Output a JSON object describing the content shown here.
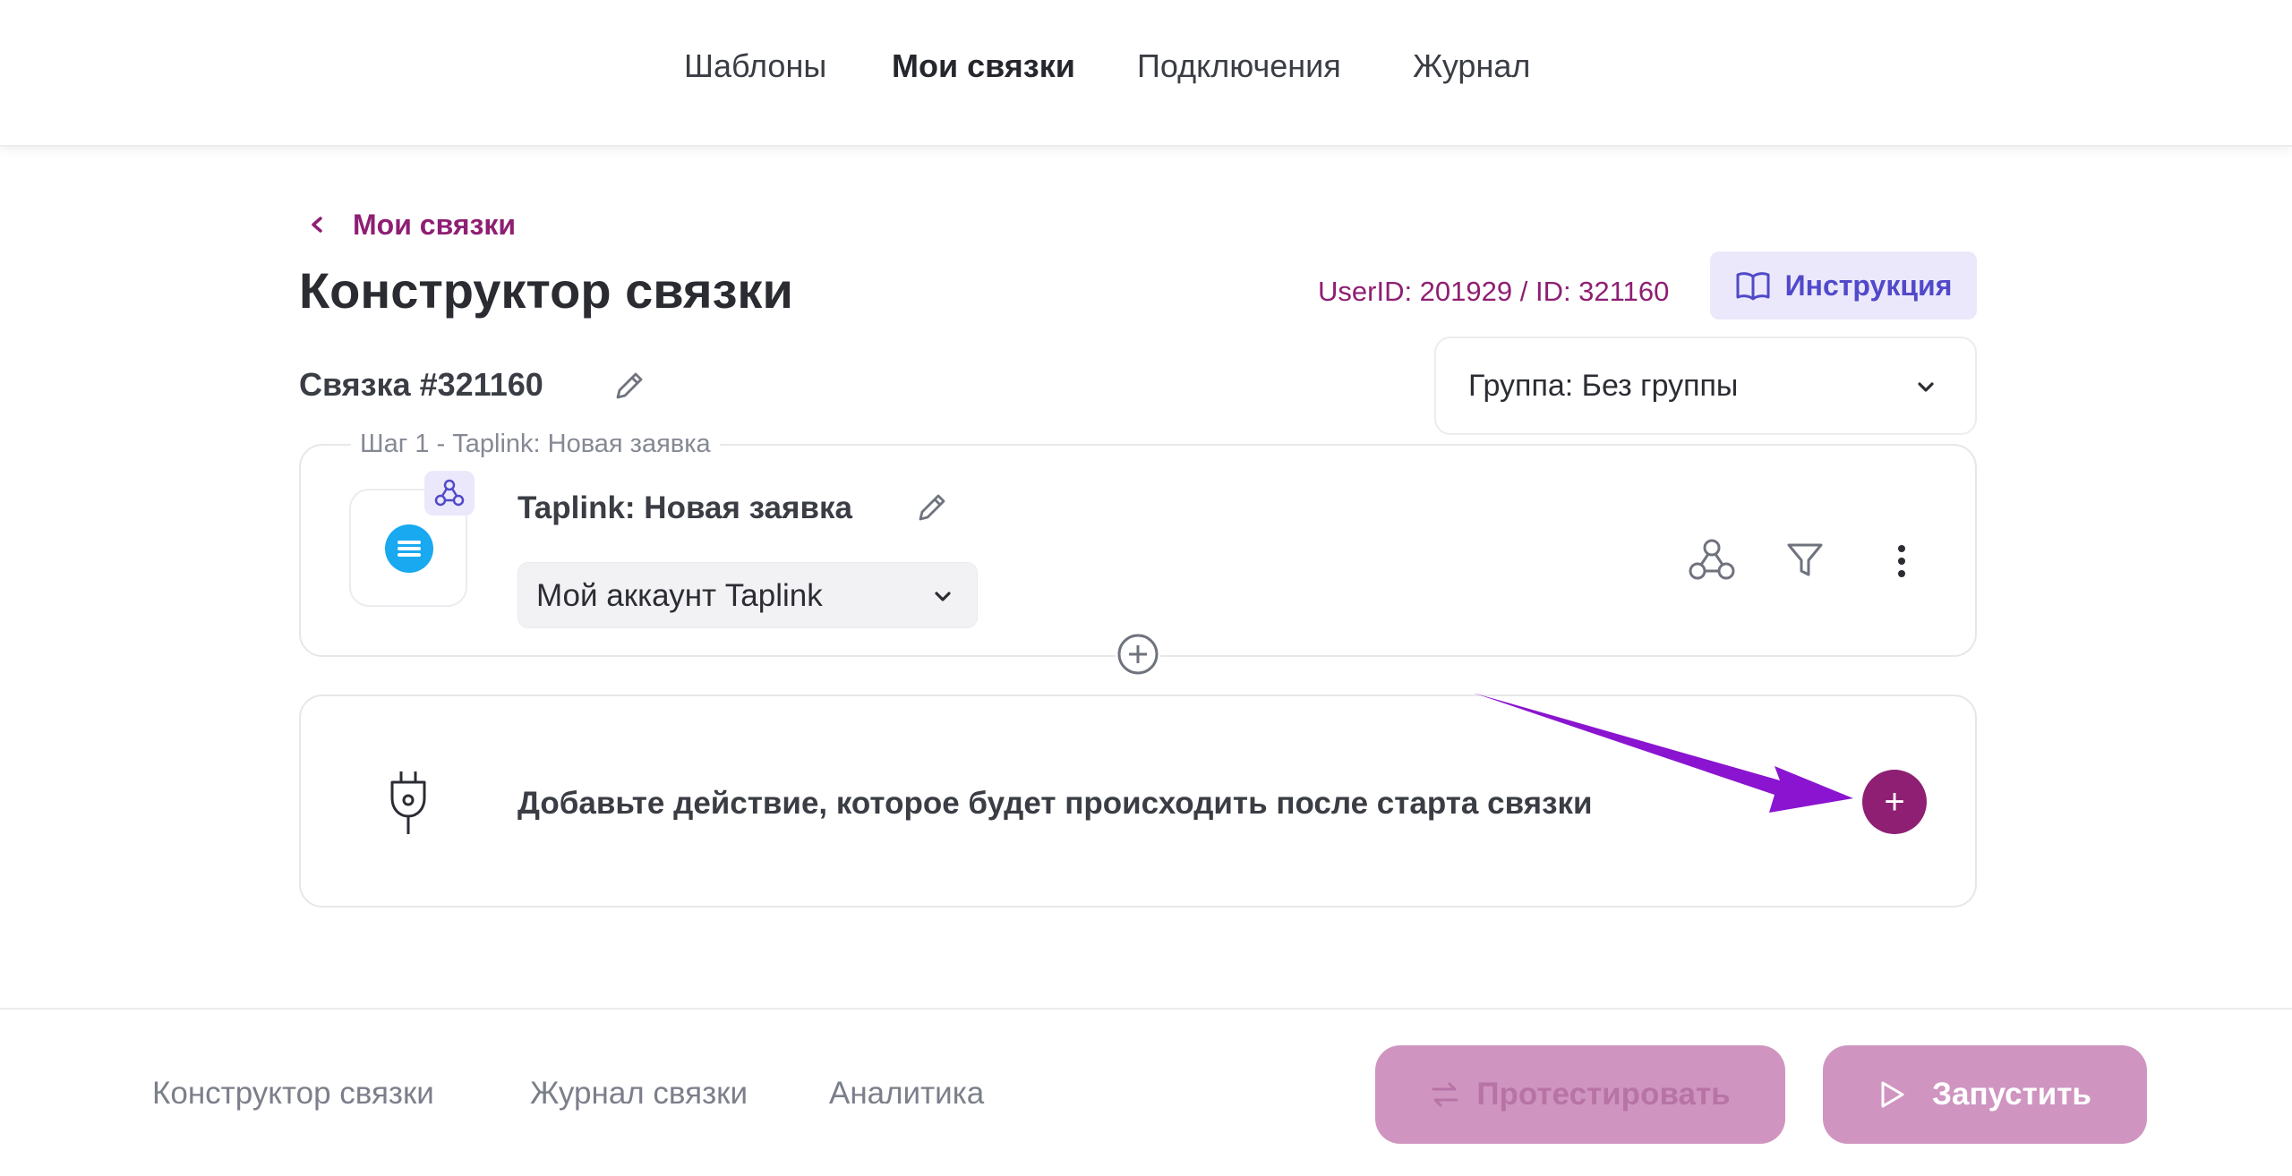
{
  "topnav": {
    "items": [
      {
        "label": "Шаблоны",
        "active": false
      },
      {
        "label": "Мои связки",
        "active": true
      },
      {
        "label": "Подключения",
        "active": false
      },
      {
        "label": "Журнал",
        "active": false
      }
    ]
  },
  "breadcrumb": {
    "label": "Мои связки"
  },
  "header": {
    "title": "Конструктор связки",
    "user_id_text": "UserID: 201929 / ID: 321160",
    "instruction_label": "Инструкция"
  },
  "link": {
    "name": "Связка #321160"
  },
  "group_select": {
    "value": "Группа: Без группы"
  },
  "step": {
    "legend": "Шаг 1 - Taplink: Новая заявка",
    "title": "Taplink: Новая заявка",
    "account_value": "Мой аккаунт Taplink",
    "app_color": "#18a9f0"
  },
  "add_action": {
    "text": "Добавьте действие, которое будет происходить после старта связки",
    "button_glyph": "+"
  },
  "bottom": {
    "tabs": [
      "Конструктор связки",
      "Журнал связки",
      "Аналитика"
    ],
    "test_label": "Протестировать",
    "run_label": "Запустить"
  },
  "colors": {
    "accent": "#8e1f73",
    "instruction_bg": "#ebe8fb",
    "instruction_text": "#5149c9",
    "disabled_button": "#cf95c0",
    "annotation_arrow": "#8a14d0"
  }
}
